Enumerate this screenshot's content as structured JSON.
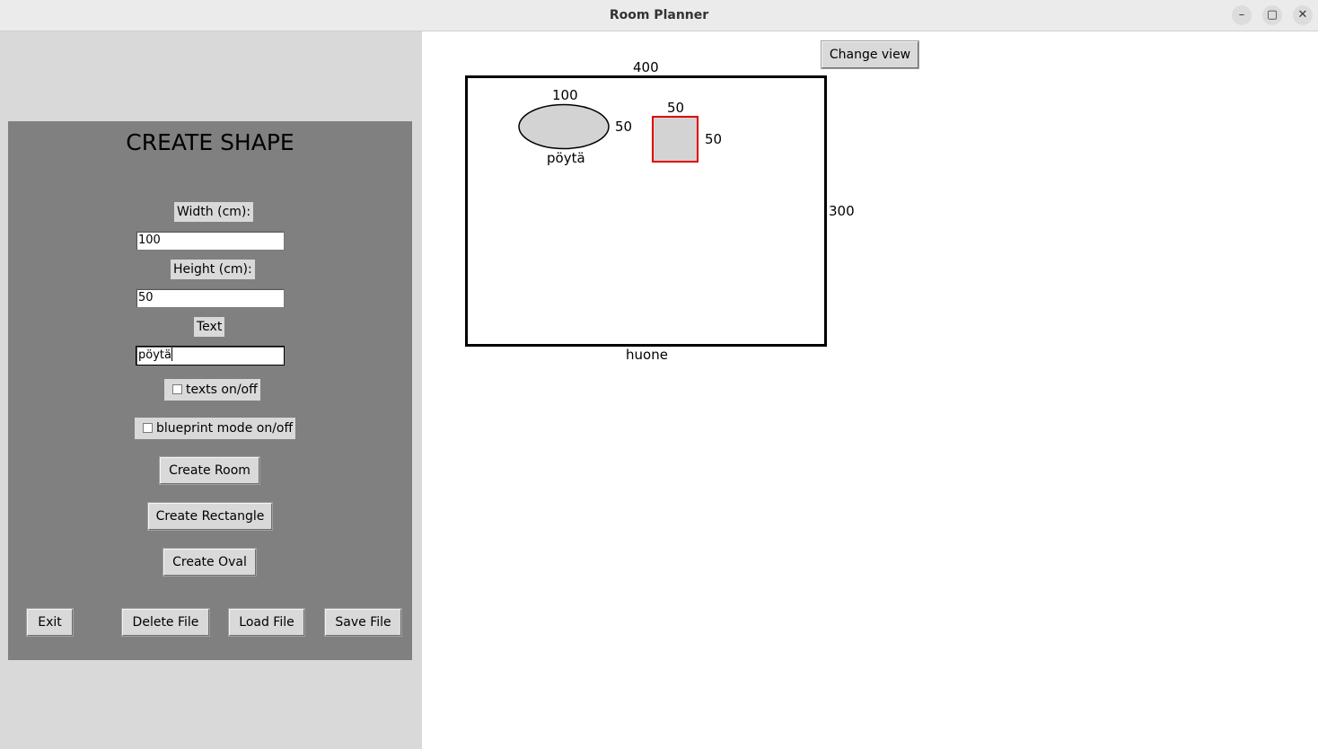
{
  "window": {
    "title": "Room Planner"
  },
  "panel": {
    "title": "CREATE SHAPE",
    "width_label": "Width (cm):",
    "width_value": "100",
    "height_label": "Height (cm):",
    "height_value": "50",
    "text_label": "Text",
    "text_value": "pöytä",
    "texts_toggle": "texts on/off",
    "blueprint_toggle": "blueprint mode on/off",
    "create_room": "Create Room",
    "create_rectangle": "Create Rectangle",
    "create_oval": "Create Oval",
    "exit": "Exit",
    "delete_file": "Delete File",
    "load_file": "Load File",
    "save_file": "Save File"
  },
  "canvas": {
    "change_view": "Change view",
    "room": {
      "name": "huone",
      "width": "400",
      "height": "300"
    },
    "oval": {
      "label": "pöytä",
      "width": "100",
      "height": "50"
    },
    "rect": {
      "width": "50",
      "height": "50"
    },
    "colors": {
      "outline": "#000000",
      "fill": "#d3d3d3",
      "selected": "#e00000"
    }
  }
}
